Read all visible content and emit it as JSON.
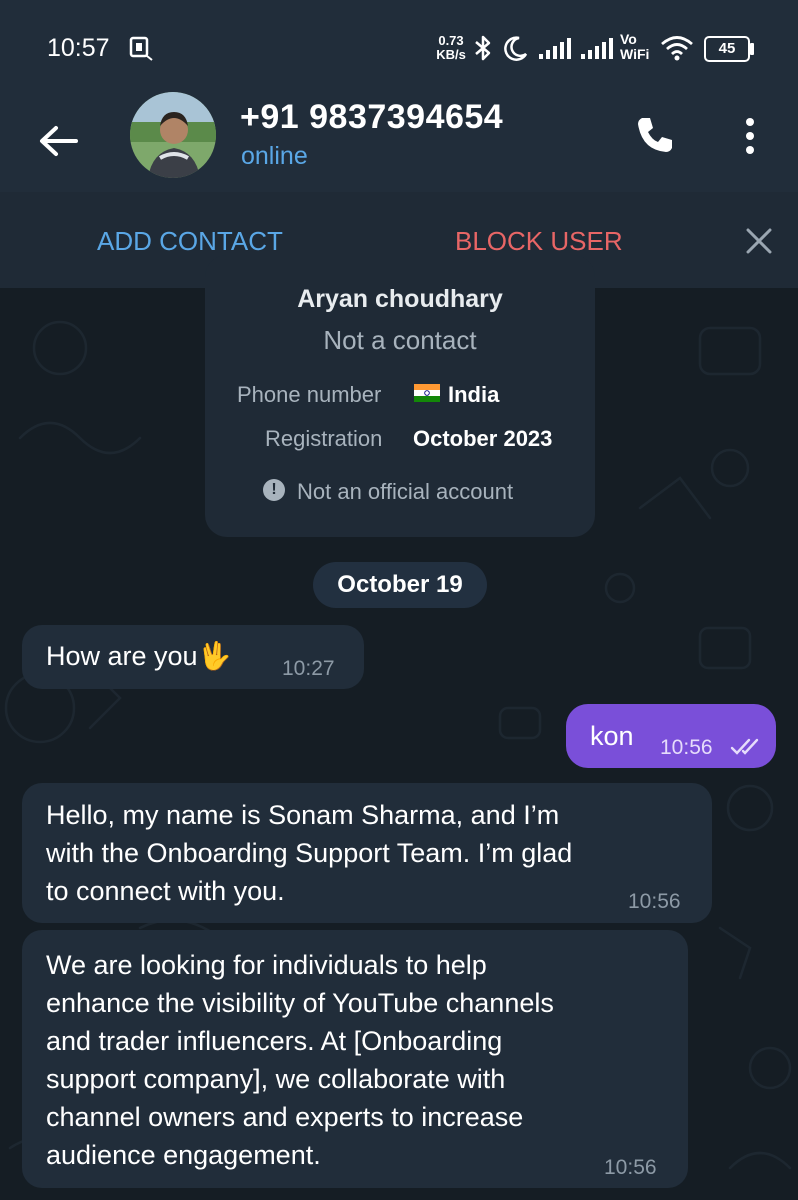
{
  "status_bar": {
    "time": "10:57",
    "net_speed_top": "0.73",
    "net_speed_bottom": "KB/s",
    "volte_top": "Vo",
    "volte_bottom": "WiFi",
    "battery": "45",
    "icons": [
      "sim-card-icon",
      "bluetooth-icon",
      "moon-icon",
      "signal-icon",
      "signal-icon",
      "wifi-icon",
      "battery-icon"
    ]
  },
  "header": {
    "contact_name": "+91 9837394654",
    "status": "online",
    "icons": [
      "back-arrow-icon",
      "avatar",
      "phone-icon",
      "more-vertical-icon"
    ]
  },
  "action_bar": {
    "add_contact": "ADD CONTACT",
    "block_user": "BLOCK USER",
    "close_icon": "close-icon"
  },
  "info_card": {
    "name": "Aryan choudhary",
    "subtitle": "Not a contact",
    "phone_label": "Phone number",
    "phone_value": "India",
    "registration_label": "Registration",
    "registration_value": "October 2023",
    "note": "Not an official account"
  },
  "date_chip": "October 19",
  "messages": [
    {
      "direction": "in",
      "text": "How are you",
      "emoji": "🖖",
      "time": "10:27"
    },
    {
      "direction": "out",
      "text": "kon",
      "time": "10:56",
      "read": true
    },
    {
      "direction": "in",
      "lines": [
        "Hello, my name is Sonam Sharma, and I’m",
        "with the Onboarding Support Team. I’m glad",
        "to connect with you."
      ],
      "time": "10:56"
    },
    {
      "direction": "in",
      "lines": [
        "We are looking for individuals to help",
        "enhance the visibility of YouTube channels",
        "and trader influencers. At [Onboarding",
        "support company], we collaborate with",
        "channel owners and experts to increase",
        "audience engagement."
      ],
      "time": "10:56"
    }
  ],
  "colors": {
    "header_bg": "#212d3a",
    "chat_bg": "#151d24",
    "accent_blue": "#5aa7e6",
    "danger_red": "#e86666",
    "outgoing_bubble": "#7a4fd9",
    "incoming_bubble": "#212d3a"
  }
}
